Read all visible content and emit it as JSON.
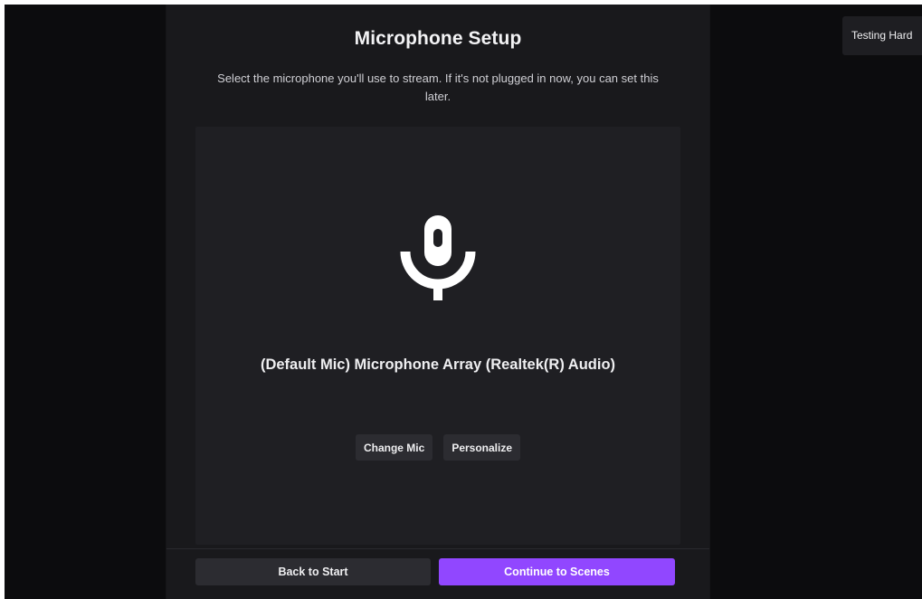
{
  "header": {
    "title": "Microphone Setup",
    "subtitle": "Select the microphone you'll use to stream. If it's not plugged in now, you can set this later."
  },
  "mic": {
    "icon": "microphone-icon",
    "device_name": "(Default Mic) Microphone Array (Realtek(R) Audio)",
    "change_label": "Change Mic",
    "personalize_label": "Personalize"
  },
  "footer": {
    "back_label": "Back to Start",
    "continue_label": "Continue to Scenes"
  },
  "corner": {
    "label": "Testing Hard"
  },
  "colors": {
    "accent": "#9147ff",
    "background": "#0c0c0e",
    "panel": "#19191c",
    "card": "#1f1f23"
  }
}
